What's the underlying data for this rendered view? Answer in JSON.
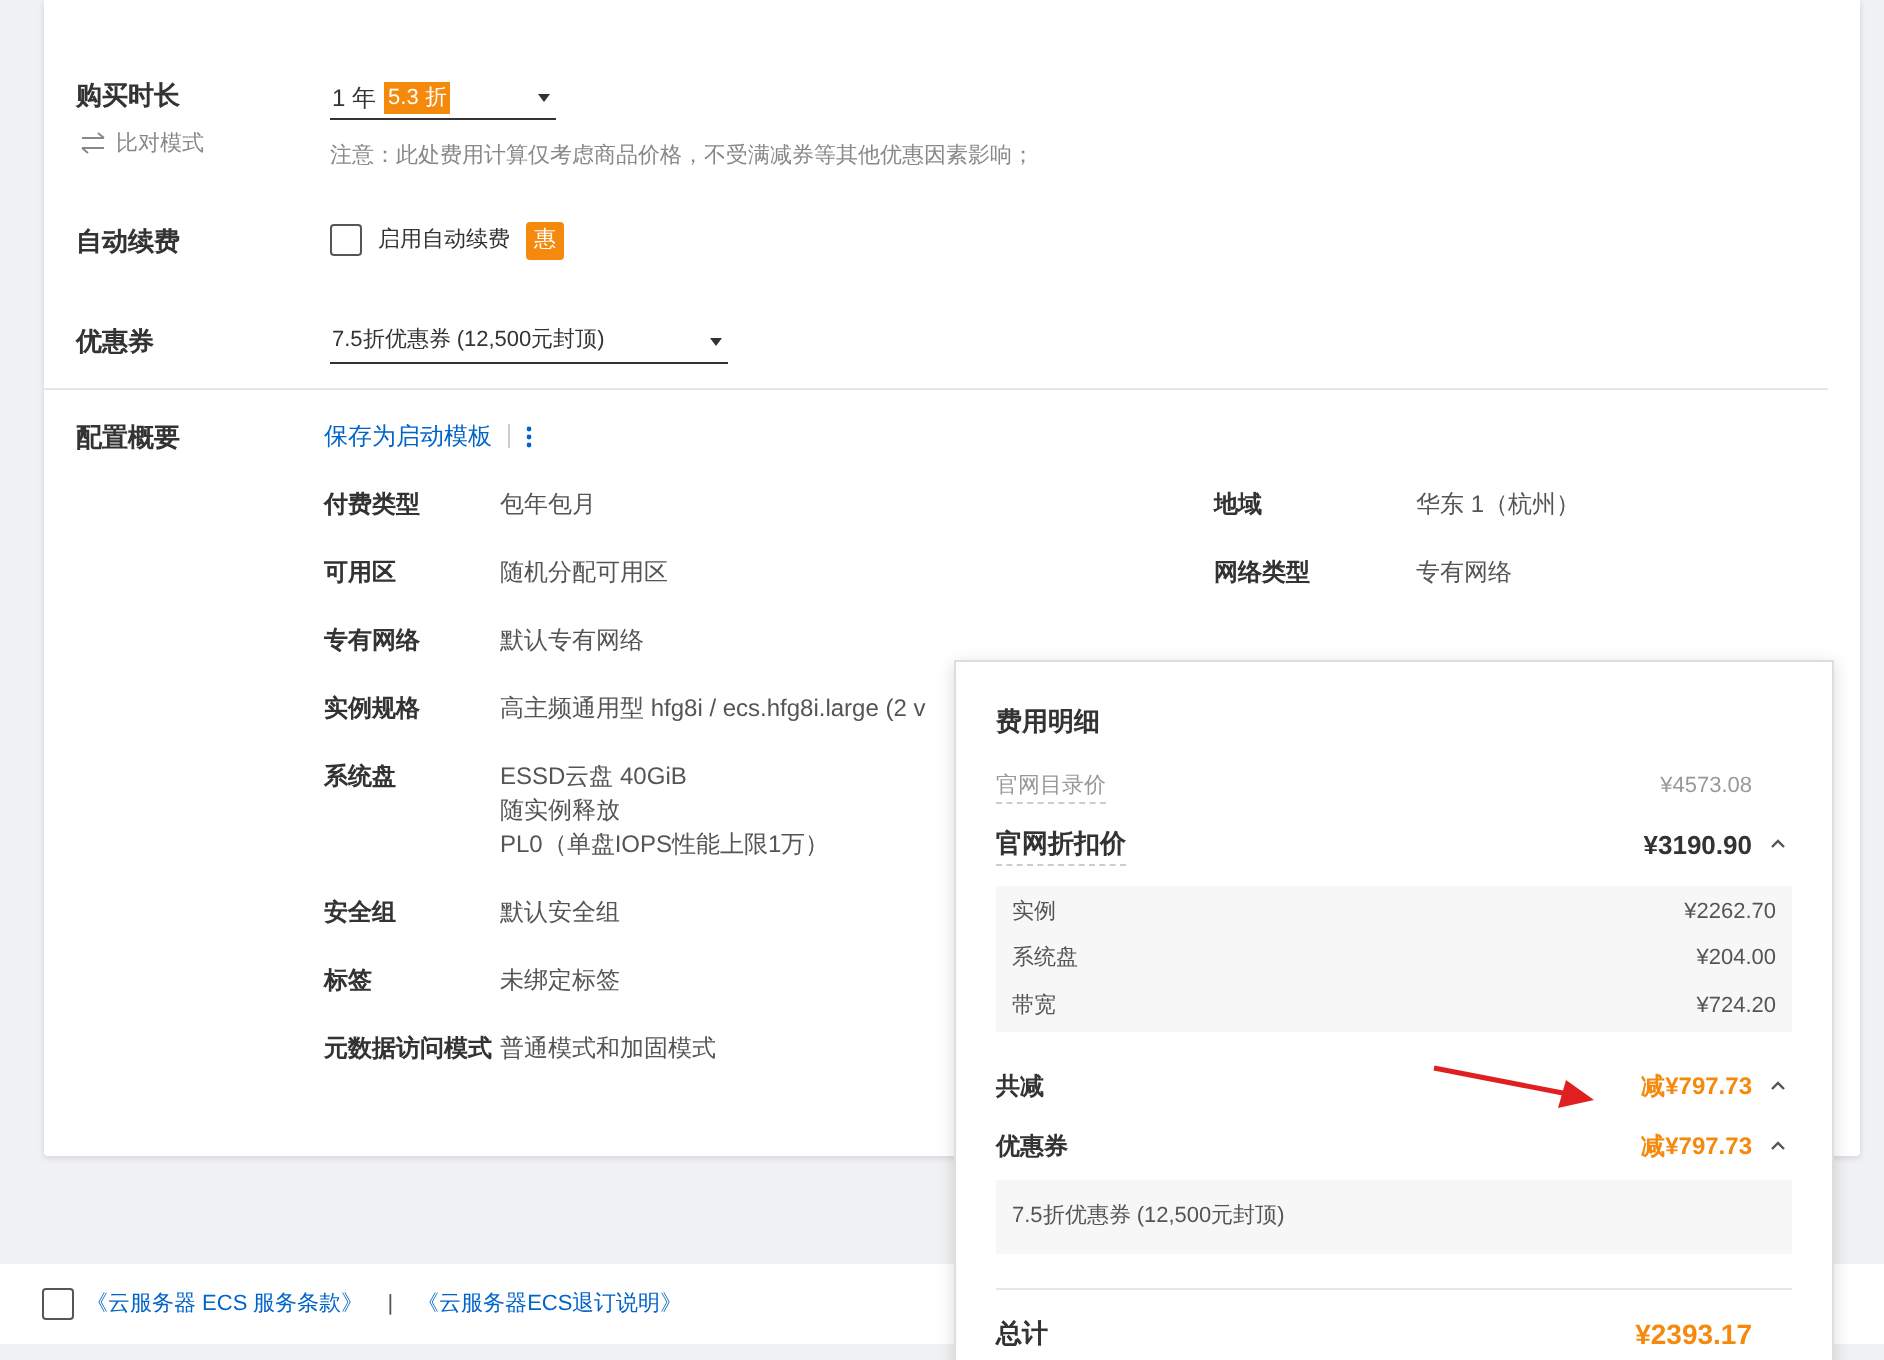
{
  "duration": {
    "label": "购买时长",
    "compare_mode": "比对模式",
    "value": "1 年",
    "discount_badge": "5.3 折",
    "note": "注意：此处费用计算仅考虑商品价格，不受满减券等其他优惠因素影响；"
  },
  "auto_renew": {
    "label": "自动续费",
    "option": "启用自动续费",
    "checked": false,
    "badge": "惠"
  },
  "coupon": {
    "label": "优惠券",
    "value": "7.5折优惠券 (12,500元封顶)"
  },
  "summary": {
    "label": "配置概要",
    "save_template": "保存为启动模板",
    "left": [
      {
        "label": "付费类型",
        "values": [
          "包年包月"
        ]
      },
      {
        "label": "可用区",
        "values": [
          "随机分配可用区"
        ]
      },
      {
        "label": "专有网络",
        "values": [
          "默认专有网络"
        ]
      },
      {
        "label": "实例规格",
        "values": [
          "高主频通用型 hfg8i / ecs.hfg8i.large (2 v"
        ]
      },
      {
        "label": "系统盘",
        "values": [
          "ESSD云盘 40GiB",
          "随实例释放",
          "PL0（单盘IOPS性能上限1万）"
        ]
      },
      {
        "label": "安全组",
        "values": [
          "默认安全组"
        ]
      },
      {
        "label": "标签",
        "values": [
          "未绑定标签"
        ]
      },
      {
        "label": "元数据访问模式",
        "values": [
          "普通模式和加固模式"
        ]
      }
    ],
    "right": [
      {
        "label": "地域",
        "values": [
          "华东 1（杭州）"
        ]
      },
      {
        "label": "网络类型",
        "values": [
          "专有网络"
        ]
      }
    ]
  },
  "cost_popover": {
    "title": "费用明细",
    "list_price": {
      "label": "官网目录价",
      "value": "¥4573.08"
    },
    "discount_price": {
      "label": "官网折扣价",
      "value": "¥3190.90",
      "expanded": true
    },
    "items": [
      {
        "label": "实例",
        "value": "¥2262.70"
      },
      {
        "label": "系统盘",
        "value": "¥204.00"
      },
      {
        "label": "带宽",
        "value": "¥724.20"
      }
    ],
    "total_reduction": {
      "label": "共减",
      "value": "减¥797.73",
      "expanded": true
    },
    "coupon_reduction": {
      "label": "优惠券",
      "value": "减¥797.73",
      "expanded": true,
      "detail": "7.5折优惠券 (12,500元封顶)"
    },
    "total": {
      "label": "总计",
      "value": "¥2393.17"
    }
  },
  "footer": {
    "checked": false,
    "links": [
      "《云服务器 ECS 服务条款》",
      "《云服务器ECS退订说明》"
    ],
    "separator": "|"
  }
}
